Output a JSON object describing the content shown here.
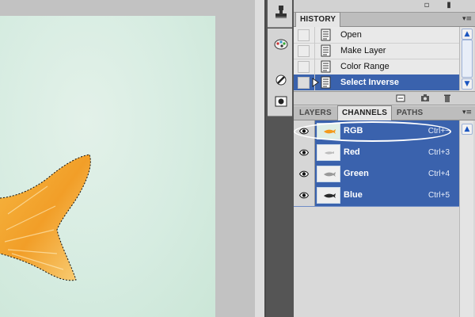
{
  "history_panel": {
    "tab_label": "HISTORY",
    "states": [
      {
        "label": "Open"
      },
      {
        "label": "Make Layer"
      },
      {
        "label": "Color Range"
      },
      {
        "label": "Select Inverse",
        "selected": true
      }
    ]
  },
  "channels_panel": {
    "tabs": [
      {
        "label": "LAYERS",
        "active": false
      },
      {
        "label": "CHANNELS",
        "active": true
      },
      {
        "label": "PATHS",
        "active": false
      }
    ],
    "channels": [
      {
        "name": "RGB",
        "shortcut": "Ctrl+~"
      },
      {
        "name": "Red",
        "shortcut": "Ctrl+3"
      },
      {
        "name": "Green",
        "shortcut": "Ctrl+4"
      },
      {
        "name": "Blue",
        "shortcut": "Ctrl+5"
      }
    ]
  },
  "colors": {
    "selection_blue": "#3a62ad",
    "canvas_mint": "#d6ece1",
    "fish_orange": "#f39a1e"
  },
  "icons": {
    "dock": [
      "stamp-icon",
      "palette-icon",
      "brush-dot-icon",
      "mask-icon"
    ],
    "history_footer": [
      "new-document-icon",
      "camera-icon",
      "trash-icon"
    ]
  }
}
